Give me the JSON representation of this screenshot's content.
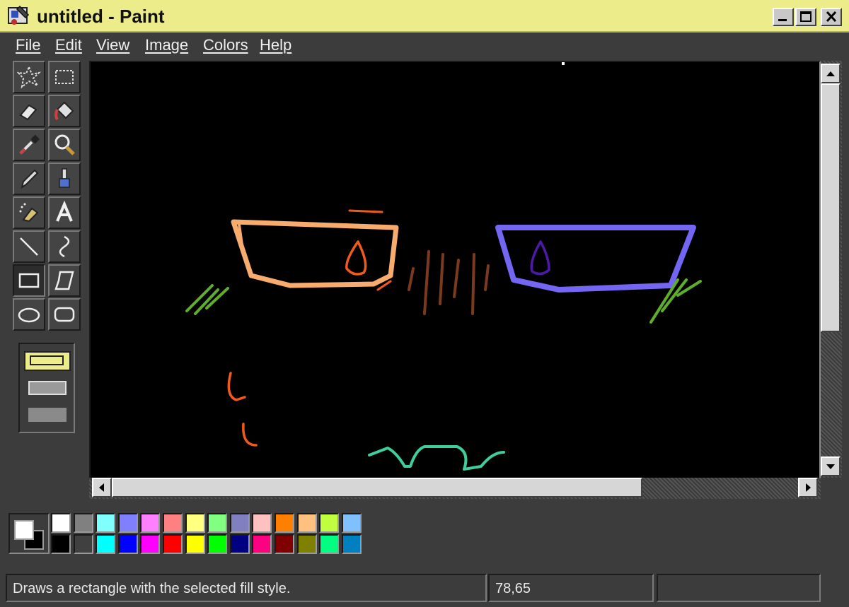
{
  "window": {
    "title": "untitled - Paint",
    "title_bar_color": "#ecec8a"
  },
  "menu": {
    "items": [
      {
        "label": "File"
      },
      {
        "label": "Edit"
      },
      {
        "label": "View"
      },
      {
        "label": "Image"
      },
      {
        "label": "Colors"
      },
      {
        "label": "Help"
      }
    ]
  },
  "tools": [
    {
      "name": "free-form-select-icon"
    },
    {
      "name": "rect-select-icon"
    },
    {
      "name": "eraser-icon"
    },
    {
      "name": "fill-bucket-icon"
    },
    {
      "name": "color-picker-icon"
    },
    {
      "name": "magnifier-icon"
    },
    {
      "name": "pencil-icon"
    },
    {
      "name": "brush-icon"
    },
    {
      "name": "airbrush-icon"
    },
    {
      "name": "text-icon",
      "glyph": "A"
    },
    {
      "name": "line-icon"
    },
    {
      "name": "curve-icon"
    },
    {
      "name": "rectangle-icon",
      "active": true
    },
    {
      "name": "polygon-icon"
    },
    {
      "name": "ellipse-icon"
    },
    {
      "name": "rounded-rectangle-icon"
    }
  ],
  "fill_styles": {
    "selected_index": 0,
    "options": [
      "outline",
      "outline-fill",
      "fill"
    ]
  },
  "palette": {
    "foreground": "#ffffff",
    "background": "#000000",
    "top_row": [
      "#ffffff",
      "#808080",
      "#80ffff",
      "#8080ff",
      "#ff80ff",
      "#ff8080",
      "#ffff80",
      "#80ff80",
      "#8080c0",
      "#ffc0c0",
      "#ff8000",
      "#ffc080",
      "#c0ff40",
      "#80c0ff"
    ],
    "bottom_row": [
      "#000000",
      "#404040",
      "#00ffff",
      "#0000ff",
      "#ff00ff",
      "#ff0000",
      "#ffff00",
      "#00ff00",
      "#000080",
      "#ff0080",
      "#800000",
      "#808000",
      "#00ff80",
      "#0080c0"
    ]
  },
  "status": {
    "message": "Draws a rectangle with the selected fill style.",
    "coordinates": "78,65",
    "size": ""
  }
}
